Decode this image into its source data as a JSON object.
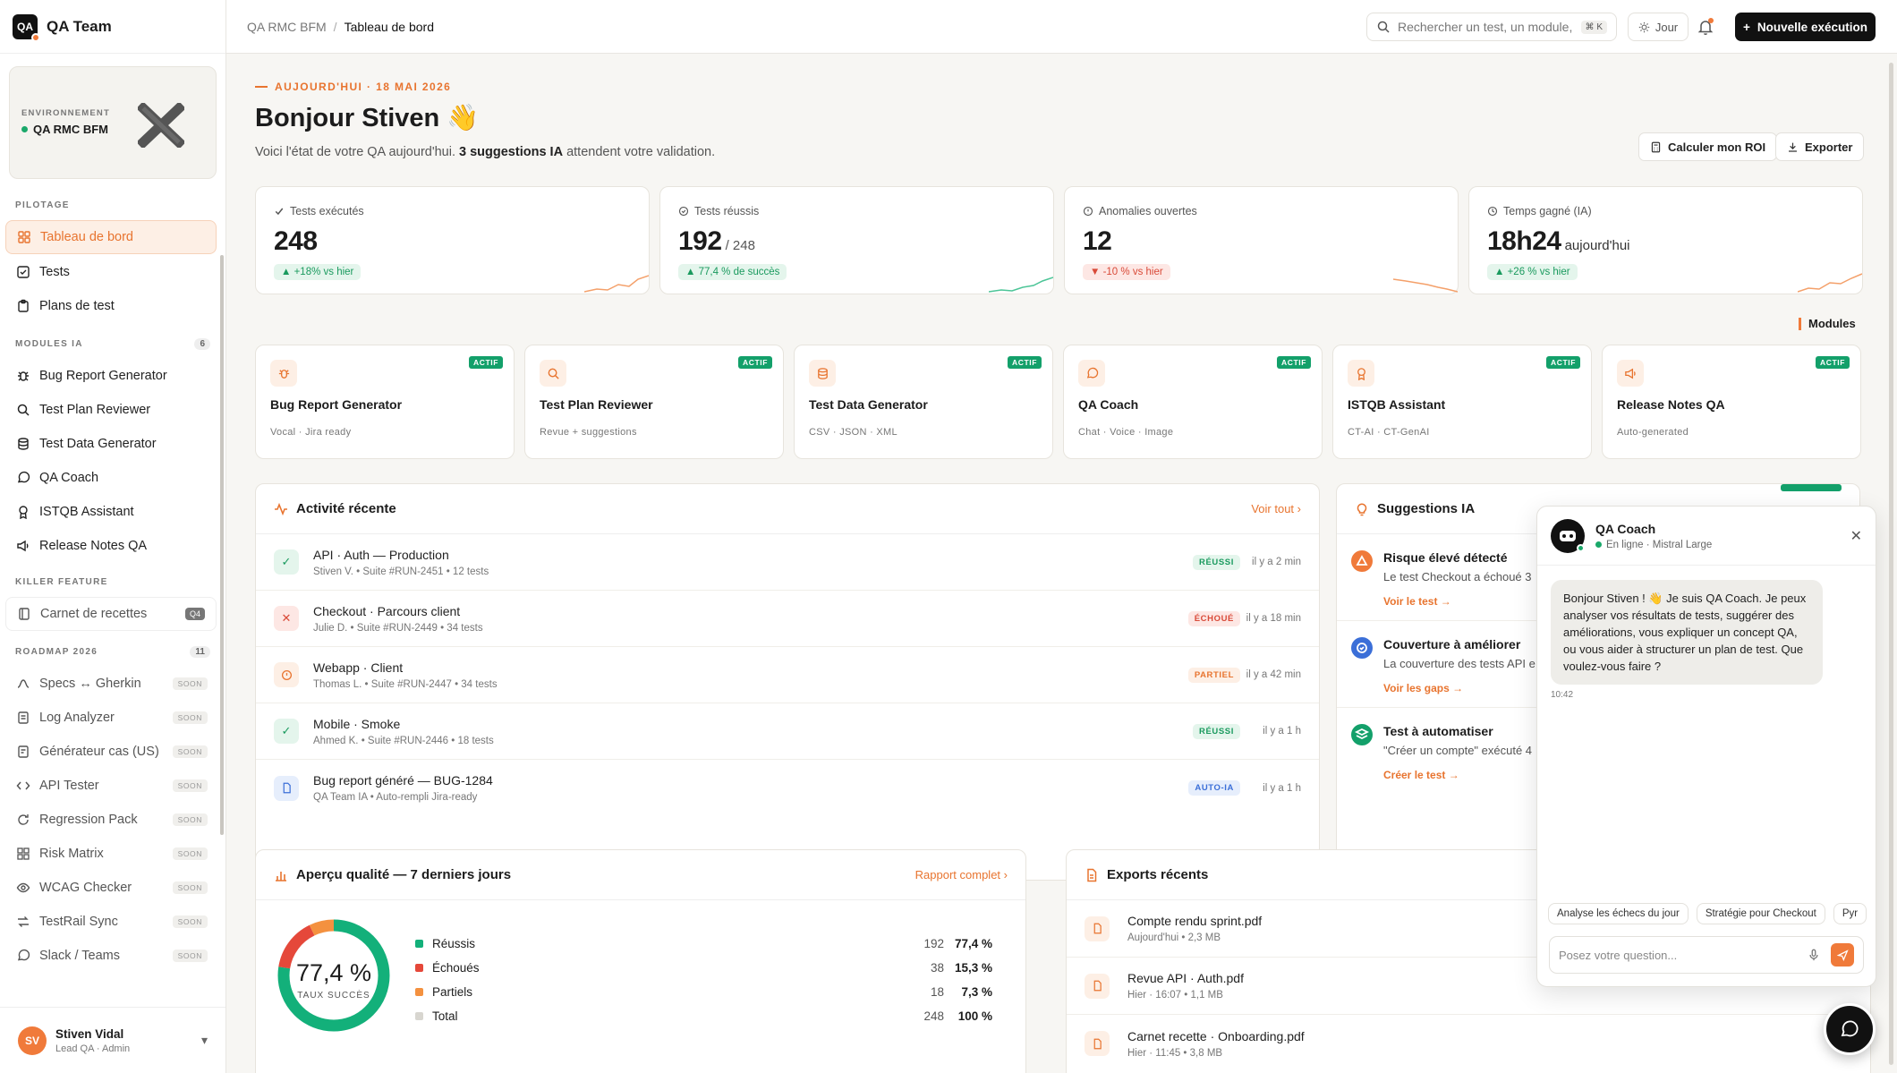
{
  "app": {
    "brand": "QA Team",
    "logo_text": "QA"
  },
  "env": {
    "label": "ENVIRONNEMENT",
    "value": "QA RMC BFM"
  },
  "sidebar": {
    "sections": {
      "pilotage": "PILOTAGE",
      "modules": "MODULES IA",
      "modules_count": "6",
      "killer": "KILLER FEATURE",
      "roadmap": "ROADMAP 2026",
      "roadmap_count": "11"
    },
    "pilotage": [
      {
        "label": "Tableau de bord",
        "icon": "grid-icon"
      },
      {
        "label": "Tests",
        "icon": "checkbox-icon"
      },
      {
        "label": "Plans de test",
        "icon": "clipboard-icon"
      }
    ],
    "modules": [
      {
        "label": "Bug Report Generator",
        "icon": "bug-icon"
      },
      {
        "label": "Test Plan Reviewer",
        "icon": "search-icon"
      },
      {
        "label": "Test Data Generator",
        "icon": "database-icon"
      },
      {
        "label": "QA Coach",
        "icon": "chat-icon"
      },
      {
        "label": "ISTQB Assistant",
        "icon": "award-icon"
      },
      {
        "label": "Release Notes QA",
        "icon": "megaphone-icon"
      }
    ],
    "killer": {
      "label": "Carnet de recettes",
      "badge": "Q4"
    },
    "roadmap": [
      {
        "label": "Specs ↔ Gherkin",
        "tag": "SOON"
      },
      {
        "label": "Log Analyzer",
        "tag": "SOON"
      },
      {
        "label": "Générateur cas (US)",
        "tag": "SOON"
      },
      {
        "label": "API Tester",
        "tag": "SOON"
      },
      {
        "label": "Regression Pack",
        "tag": "SOON"
      },
      {
        "label": "Risk Matrix",
        "tag": "SOON"
      },
      {
        "label": "WCAG Checker",
        "tag": "SOON"
      },
      {
        "label": "TestRail Sync",
        "tag": "SOON"
      },
      {
        "label": "Slack / Teams",
        "tag": "SOON"
      }
    ],
    "user": {
      "initials": "SV",
      "name": "Stiven Vidal",
      "role": "Lead QA · Admin"
    }
  },
  "topbar": {
    "crumb_root": "QA RMC BFM",
    "crumb_sep": "/",
    "crumb_page": "Tableau de bord",
    "search_placeholder": "Rechercher un test, un module,",
    "search_kbd": "⌘ K",
    "day": "Jour",
    "new_run": "Nouvelle exécution"
  },
  "header": {
    "eyebrow": "AUJOURD'HUI · 18 MAI 2026",
    "greeting": "Bonjour Stiven 👋",
    "sub_pre": "Voici l'état de votre QA aujourd'hui. ",
    "sub_bold": "3 suggestions IA",
    "sub_post": " attendent votre validation.",
    "roi": "Calculer mon ROI",
    "export": "Exporter"
  },
  "kpis": [
    {
      "label": "Tests exécutés",
      "value": "248",
      "suffix": "",
      "delta": "+18% vs hier",
      "trend": "up",
      "color": "#f07a3a"
    },
    {
      "label": "Tests réussis",
      "value": "192",
      "suffix": "/ 248",
      "delta": "77,4 % de succès",
      "trend": "up",
      "color": "#1aa86a"
    },
    {
      "label": "Anomalies ouvertes",
      "value": "12",
      "suffix": "",
      "delta": "-10 % vs hier",
      "trend": "down",
      "color": "#f07a3a"
    },
    {
      "label": "Temps gagné (IA)",
      "value": "18h24",
      "suffix": "aujourd'hui",
      "delta": "+26 % vs hier",
      "trend": "up",
      "color": "#f07a3a"
    }
  ],
  "modules_title": "Modules",
  "modules": [
    {
      "name": "Bug Report Generator",
      "sub": "Vocal · Jira ready",
      "status": "ACTIF",
      "icon": "bug-icon"
    },
    {
      "name": "Test Plan Reviewer",
      "sub": "Revue + suggestions",
      "status": "ACTIF",
      "icon": "search-icon"
    },
    {
      "name": "Test Data Generator",
      "sub": "CSV · JSON · XML",
      "status": "ACTIF",
      "icon": "database-icon"
    },
    {
      "name": "QA Coach",
      "sub": "Chat · Voice · Image",
      "status": "ACTIF",
      "icon": "chat-icon"
    },
    {
      "name": "ISTQB Assistant",
      "sub": "CT-AI · CT-GenAI",
      "status": "ACTIF",
      "icon": "award-icon"
    },
    {
      "name": "Release Notes QA",
      "sub": "Auto-generated",
      "status": "ACTIF",
      "icon": "megaphone-icon"
    }
  ],
  "activity": {
    "title": "Activité récente",
    "link": "Voir tout",
    "rows": [
      {
        "title": "API · Auth — Production",
        "meta": "Stiven V.  •  Suite #RUN-2451  •  12 tests",
        "status": "RÉUSSI",
        "kind": "ok",
        "time": "il y a 2 min"
      },
      {
        "title": "Checkout · Parcours client",
        "meta": "Julie D.  •  Suite #RUN-2449  •  34 tests",
        "status": "ÉCHOUÉ",
        "kind": "ko",
        "time": "il y a 18 min"
      },
      {
        "title": "Webapp · Client",
        "meta": "Thomas L.  •  Suite #RUN-2447  •  34 tests",
        "status": "PARTIEL",
        "kind": "part",
        "time": "il y a 42 min"
      },
      {
        "title": "Mobile · Smoke",
        "meta": "Ahmed K.  •  Suite #RUN-2446  •  18 tests",
        "status": "RÉUSSI",
        "kind": "ok",
        "time": "il y a 1 h"
      },
      {
        "title": "Bug report généré — BUG-1284",
        "meta": "QA Team IA  •  Auto-rempli Jira-ready",
        "status": "AUTO-IA",
        "kind": "ai",
        "time": "il y a 1 h"
      }
    ]
  },
  "suggestions": {
    "title": "Suggestions IA",
    "items": [
      {
        "title": "Risque élevé détecté",
        "desc": "Le test Checkout a échoué 3",
        "link": "Voir le test →",
        "color": "#f07a3a"
      },
      {
        "title": "Couverture à améliorer",
        "desc": "La couverture des tests API e",
        "link": "Voir les gaps →",
        "color": "#3b6fd8"
      },
      {
        "title": "Test à automatiser",
        "desc": "\"Créer un compte\" exécuté 4",
        "link": "Créer le test →",
        "color": "#13a06a"
      }
    ]
  },
  "quality": {
    "title": "Aperçu qualité — 7 derniers jours",
    "link": "Rapport complet",
    "center_value": "77,4 %",
    "center_label": "TAUX SUCCÈS"
  },
  "chart_data": {
    "type": "pie",
    "title": "Aperçu qualité — 7 derniers jours",
    "categories": [
      "Réussis",
      "Échoués",
      "Partiels"
    ],
    "values": [
      192,
      38,
      18
    ],
    "colors": [
      "#13b07a",
      "#e5483a",
      "#f4913f"
    ],
    "legend": [
      {
        "label": "Réussis",
        "count": "192",
        "pct": "77,4 %",
        "color": "#13b07a"
      },
      {
        "label": "Échoués",
        "count": "38",
        "pct": "15,3 %",
        "color": "#e5483a"
      },
      {
        "label": "Partiels",
        "count": "18",
        "pct": "7,3 %",
        "color": "#f4913f"
      },
      {
        "label": "Total",
        "count": "248",
        "pct": "100 %",
        "color": "#d8d6d0"
      }
    ]
  },
  "exports": {
    "title": "Exports récents",
    "rows": [
      {
        "name": "Compte rendu sprint.pdf",
        "meta": "Aujourd'hui  •  2,3 MB"
      },
      {
        "name": "Revue API · Auth.pdf",
        "meta": "Hier · 16:07  •  1,1 MB"
      },
      {
        "name": "Carnet recette · Onboarding.pdf",
        "meta": "Hier · 11:45  •  3,8 MB"
      }
    ]
  },
  "chat": {
    "title": "QA Coach",
    "status": "En ligne · Mistral Large",
    "message": "Bonjour Stiven ! 👋 Je suis QA Coach. Je peux analyser vos résultats de tests, suggérer des améliorations, vous expliquer un concept QA, ou vous aider à structurer un plan de test. Que voulez-vous faire ?",
    "time": "10:42",
    "chips": [
      "Analyse les échecs du jour",
      "Stratégie pour Checkout",
      "Pyr"
    ],
    "placeholder": "Posez votre question..."
  }
}
